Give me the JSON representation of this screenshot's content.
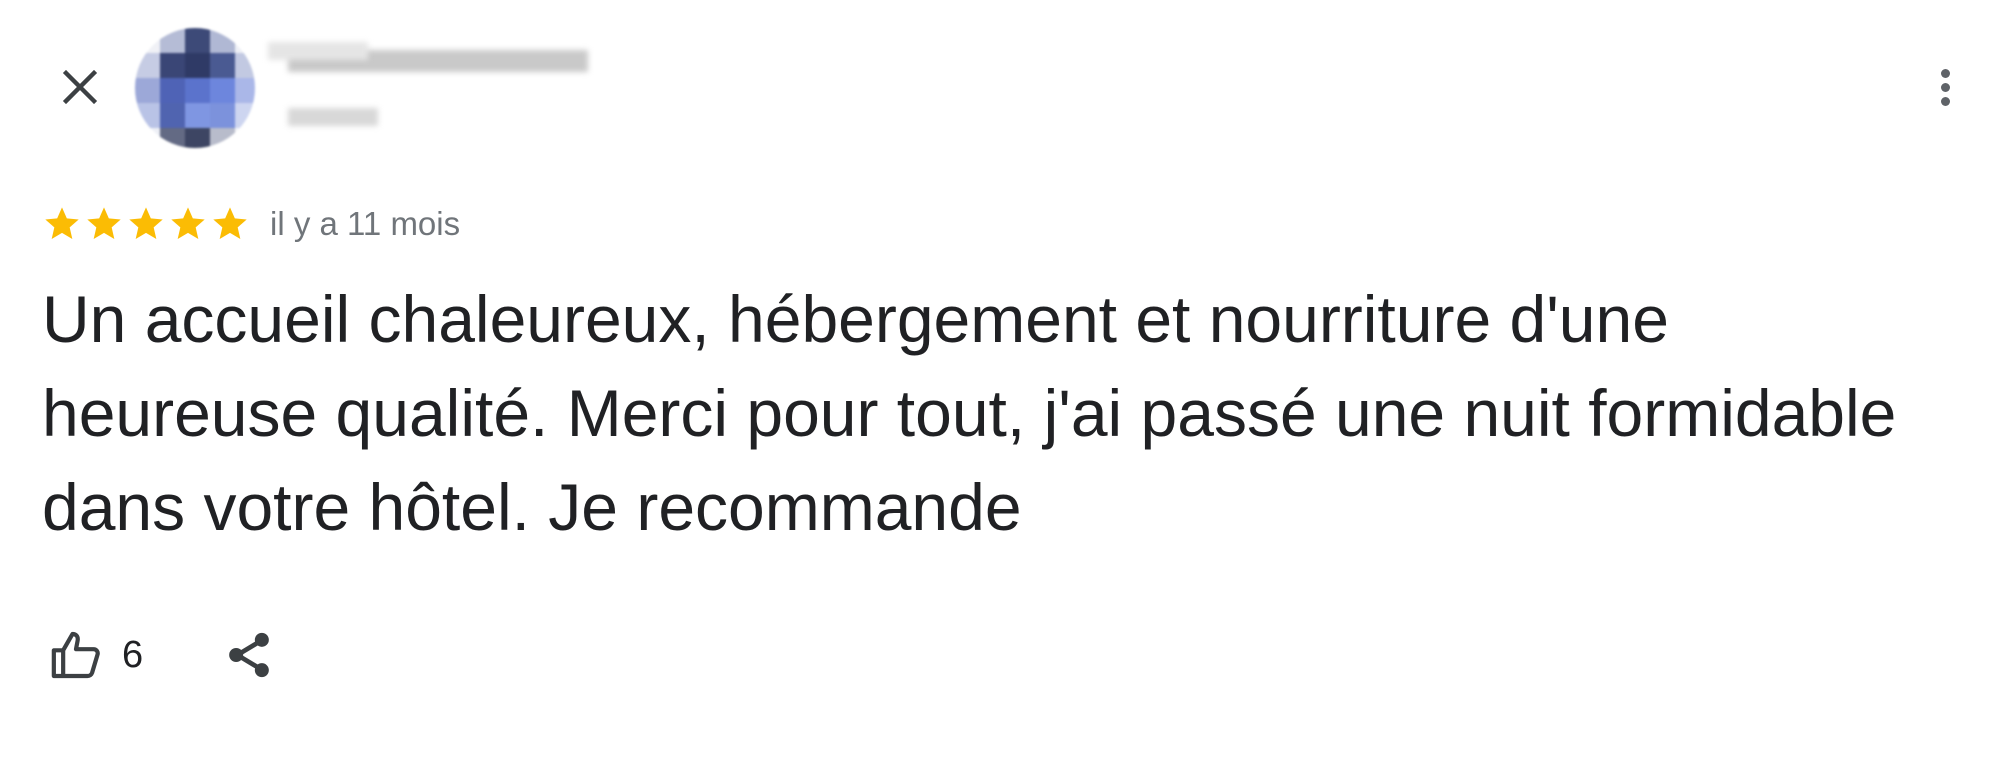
{
  "header": {
    "close_icon": "close-icon",
    "more_icon": "more-vert-icon"
  },
  "review": {
    "stars": 5,
    "star_color": "#fbbc04",
    "time_ago": "il y a 11 mois",
    "text": "Un accueil chaleureux, hébergement et nourriture d'une heureuse qualité. Merci pour tout, j'ai passé une nuit formidable dans votre hôtel. Je recommande"
  },
  "actions": {
    "like_icon": "thumb-up-icon",
    "like_count": "6",
    "share_icon": "share-icon"
  }
}
